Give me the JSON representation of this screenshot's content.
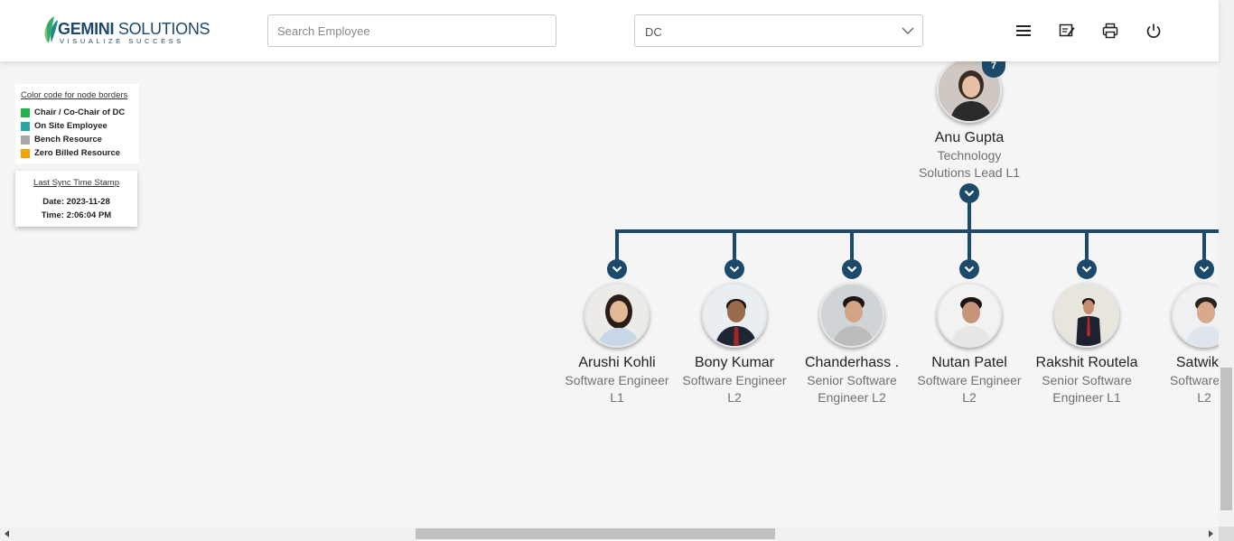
{
  "header": {
    "logo": {
      "word_bold": "GEMINI",
      "word_rest": " SOLUTIONS",
      "tagline": "VISUALIZE SUCCESS"
    },
    "search_placeholder": "Search Employee",
    "dc_select_value": "DC",
    "menu_icon": "hamburger-menu-icon",
    "feedback_icon": "edit-note-icon",
    "print_icon": "printer-icon",
    "logout_icon": "power-icon"
  },
  "legend": {
    "title": "Color code for node borders",
    "items": [
      {
        "label": "Chair / Co-Chair of DC",
        "color": "#22b14c"
      },
      {
        "label": "On Site Employee",
        "color": "#2aa6a6"
      },
      {
        "label": "Bench Resource",
        "color": "#a8a8a8"
      },
      {
        "label": "Zero Billed Resource",
        "color": "#f5a300"
      }
    ]
  },
  "sync": {
    "title": "Last Sync Time Stamp",
    "date": "Date: 2023-11-28",
    "time": "Time: 2:06:04 PM"
  },
  "org": {
    "accent_color": "#1d4a6b",
    "root": {
      "name": "Anu Gupta",
      "role_line1": "Technology",
      "role_line2": "Solutions Lead L1",
      "badge": "7"
    },
    "children": [
      {
        "name": "Arushi Kohli",
        "role_line1": "Software Engineer",
        "role_line2": "L1"
      },
      {
        "name": "Bony Kumar",
        "role_line1": "Software Engineer",
        "role_line2": "L2"
      },
      {
        "name": "Chanderhass .",
        "role_line1": "Senior Software",
        "role_line2": "Engineer L2"
      },
      {
        "name": "Nutan Patel",
        "role_line1": "Software Engineer",
        "role_line2": "L2"
      },
      {
        "name": "Rakshit Routela",
        "role_line1": "Senior Software",
        "role_line2": "Engineer L1"
      },
      {
        "name": "Satwik S",
        "role_line1": "Software En",
        "role_line2": "L2"
      }
    ]
  }
}
